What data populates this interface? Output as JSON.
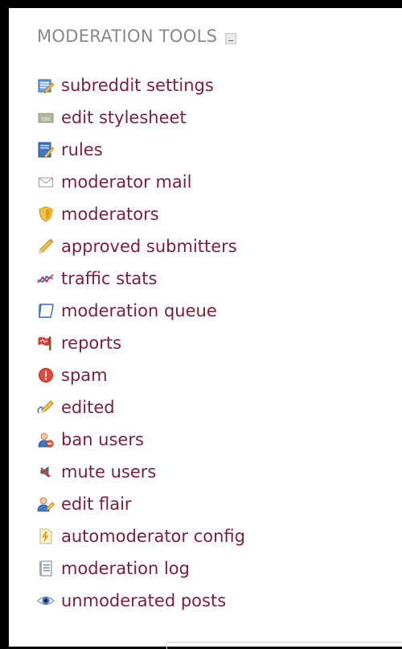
{
  "panel": {
    "title": "MODERATION TOOLS",
    "collapse_label": "-"
  },
  "items": [
    {
      "label": "subreddit settings",
      "icon": "settings-icon"
    },
    {
      "label": "edit stylesheet",
      "icon": "css-icon"
    },
    {
      "label": "rules",
      "icon": "rules-icon"
    },
    {
      "label": "moderator mail",
      "icon": "mail-icon"
    },
    {
      "label": "moderators",
      "icon": "shield-icon"
    },
    {
      "label": "approved submitters",
      "icon": "pencil-icon"
    },
    {
      "label": "traffic stats",
      "icon": "traffic-icon"
    },
    {
      "label": "moderation queue",
      "icon": "queue-icon"
    },
    {
      "label": "reports",
      "icon": "flag-icon"
    },
    {
      "label": "spam",
      "icon": "spam-icon"
    },
    {
      "label": "edited",
      "icon": "edited-icon"
    },
    {
      "label": "ban users",
      "icon": "ban-user-icon"
    },
    {
      "label": "mute users",
      "icon": "mute-icon"
    },
    {
      "label": "edit flair",
      "icon": "flair-icon"
    },
    {
      "label": "automoderator config",
      "icon": "automod-icon"
    },
    {
      "label": "moderation log",
      "icon": "log-icon"
    },
    {
      "label": "unmoderated posts",
      "icon": "eye-icon"
    }
  ],
  "colors": {
    "link": "#7b1e38",
    "header": "#888888"
  }
}
